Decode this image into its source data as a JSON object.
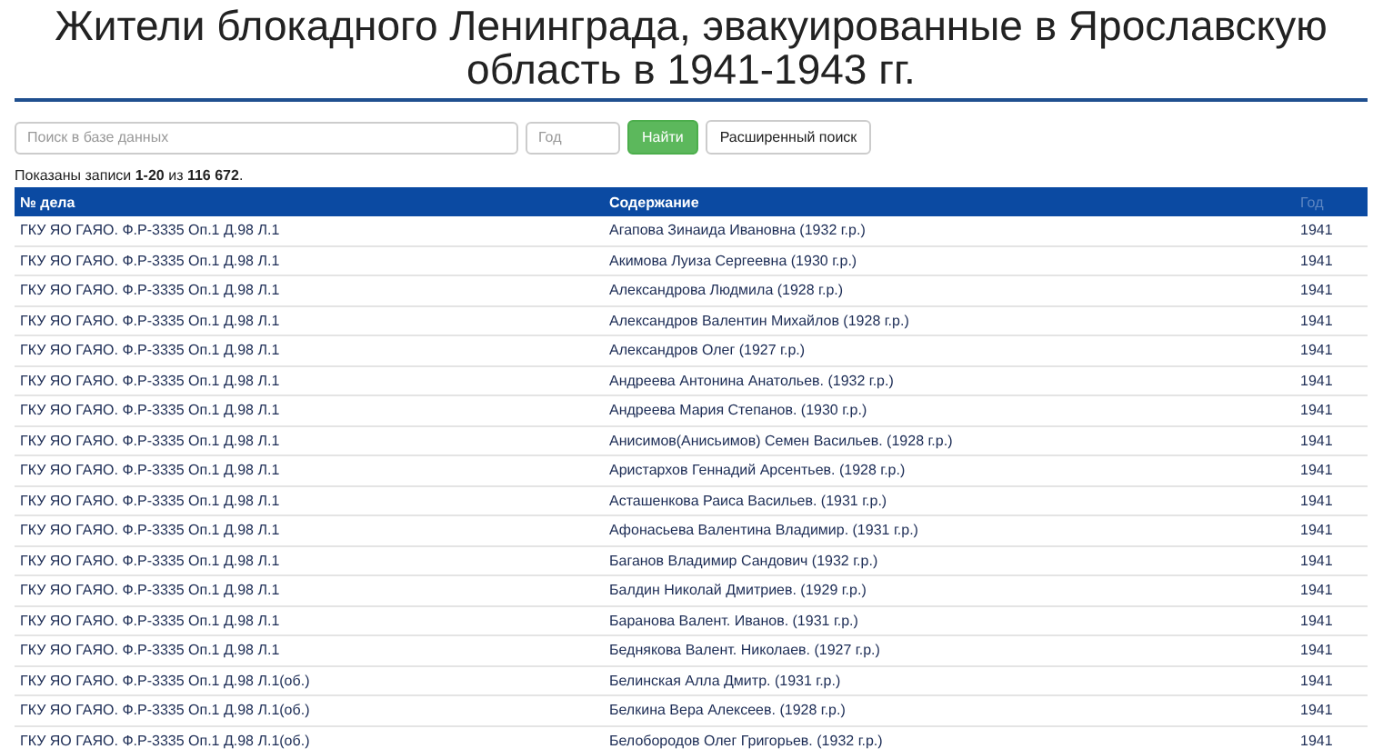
{
  "title": "Жители блокадного Ленинграда, эвакуированные в Ярославскую область в 1941-1943 гг.",
  "search": {
    "query_placeholder": "Поиск в базе данных",
    "year_placeholder": "Год",
    "submit_label": "Найти",
    "advanced_label": "Расширенный поиск"
  },
  "summary": "Показаны записи **1-20** из **116 672**.",
  "table": {
    "columns": [
      "№ дела",
      "Содержание",
      "Год"
    ],
    "rows": [
      [
        "ГКУ ЯО ГАЯО. Ф.Р-3335 Оп.1 Д.98 Л.1",
        "Агапова Зинаида Ивановна (1932 г.р.)",
        "1941"
      ],
      [
        "ГКУ ЯО ГАЯО. Ф.Р-3335 Оп.1 Д.98 Л.1",
        "Акимова Луиза Сергеевна (1930 г.р.)",
        "1941"
      ],
      [
        "ГКУ ЯО ГАЯО. Ф.Р-3335 Оп.1 Д.98 Л.1",
        "Александрова Людмила (1928 г.р.)",
        "1941"
      ],
      [
        "ГКУ ЯО ГАЯО. Ф.Р-3335 Оп.1 Д.98 Л.1",
        "Александров Валентин Михайлов (1928 г.р.)",
        "1941"
      ],
      [
        "ГКУ ЯО ГАЯО. Ф.Р-3335 Оп.1 Д.98 Л.1",
        "Александров Олег (1927 г.р.)",
        "1941"
      ],
      [
        "ГКУ ЯО ГАЯО. Ф.Р-3335 Оп.1 Д.98 Л.1",
        "Андреева Антонина Анатольев. (1932 г.р.)",
        "1941"
      ],
      [
        "ГКУ ЯО ГАЯО. Ф.Р-3335 Оп.1 Д.98 Л.1",
        "Андреева Мария Степанов. (1930 г.р.)",
        "1941"
      ],
      [
        "ГКУ ЯО ГАЯО. Ф.Р-3335 Оп.1 Д.98 Л.1",
        "Анисимов(Анисьимов) Семен Васильев. (1928 г.р.)",
        "1941"
      ],
      [
        "ГКУ ЯО ГАЯО. Ф.Р-3335 Оп.1 Д.98 Л.1",
        "Аристархов Геннадий Арсентьев. (1928 г.р.)",
        "1941"
      ],
      [
        "ГКУ ЯО ГАЯО. Ф.Р-3335 Оп.1 Д.98 Л.1",
        "Асташенкова Раиса Васильев. (1931 г.р.)",
        "1941"
      ],
      [
        "ГКУ ЯО ГАЯО. Ф.Р-3335 Оп.1 Д.98 Л.1",
        "Афонасьева Валентина Владимир. (1931 г.р.)",
        "1941"
      ],
      [
        "ГКУ ЯО ГАЯО. Ф.Р-3335 Оп.1 Д.98 Л.1",
        "Баганов Владимир Сандович (1932 г.р.)",
        "1941"
      ],
      [
        "ГКУ ЯО ГАЯО. Ф.Р-3335 Оп.1 Д.98 Л.1",
        "Балдин Николай Дмитриев. (1929 г.р.)",
        "1941"
      ],
      [
        "ГКУ ЯО ГАЯО. Ф.Р-3335 Оп.1 Д.98 Л.1",
        "Баранова Валент. Иванов. (1931 г.р.)",
        "1941"
      ],
      [
        "ГКУ ЯО ГАЯО. Ф.Р-3335 Оп.1 Д.98 Л.1",
        "Беднякова Валент. Николаев. (1927 г.р.)",
        "1941"
      ],
      [
        "ГКУ ЯО ГАЯО. Ф.Р-3335 Оп.1 Д.98 Л.1(об.)",
        "Белинская Алла Дмитр. (1931 г.р.)",
        "1941"
      ],
      [
        "ГКУ ЯО ГАЯО. Ф.Р-3335 Оп.1 Д.98 Л.1(об.)",
        "Белкина Вера Алексеев. (1928 г.р.)",
        "1941"
      ],
      [
        "ГКУ ЯО ГАЯО. Ф.Р-3335 Оп.1 Д.98 Л.1(об.)",
        "Белобородов Олег Григорьев. (1932 г.р.)",
        "1941"
      ]
    ]
  }
}
